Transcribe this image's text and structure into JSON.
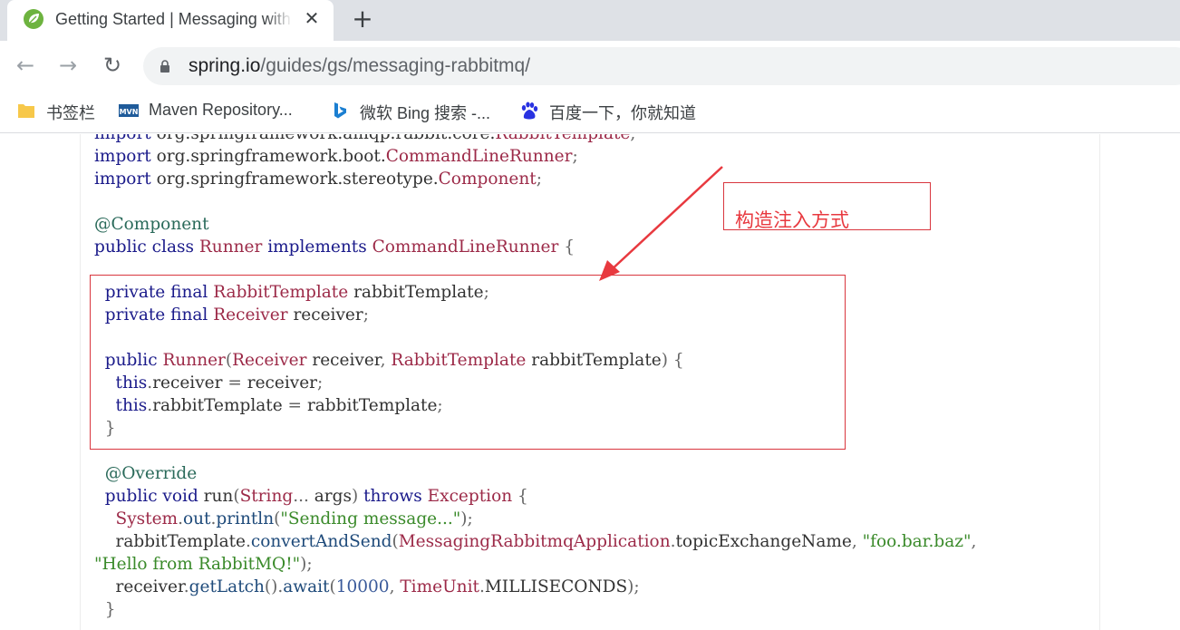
{
  "browser": {
    "tab": {
      "title": "Getting Started | Messaging with RabbitMQ",
      "close": "✕"
    },
    "new_tab": "+",
    "nav": {
      "back": "←",
      "forward": "→",
      "reload": "↻"
    },
    "address": {
      "domain": "spring.io",
      "path": "/guides/gs/messaging-rabbitmq/"
    },
    "bookmarks": [
      {
        "label": "书签栏",
        "icon": "folder-icon"
      },
      {
        "label": "Maven Repository...",
        "icon": "maven-icon"
      },
      {
        "label": "微软 Bing 搜索 -...",
        "icon": "bing-icon"
      },
      {
        "label": "百度一下，你就知道",
        "icon": "baidu-icon"
      }
    ]
  },
  "code": {
    "lines": [
      [
        [
          "kw",
          "import "
        ],
        [
          "",
          "org.springframework.amqp.rabbit.core."
        ],
        [
          "ty",
          "RabbitTemplate"
        ],
        [
          "pn",
          ";"
        ]
      ],
      [
        [
          "kw",
          "import "
        ],
        [
          "",
          "org.springframework.boot."
        ],
        [
          "ty",
          "CommandLineRunner"
        ],
        [
          "pn",
          ";"
        ]
      ],
      [
        [
          "kw",
          "import "
        ],
        [
          "",
          "org.springframework.stereotype."
        ],
        [
          "ty",
          "Component"
        ],
        [
          "pn",
          ";"
        ]
      ],
      [],
      [
        [
          "an",
          "@Component"
        ]
      ],
      [
        [
          "kw",
          "public class "
        ],
        [
          "ty",
          "Runner "
        ],
        [
          "kw",
          "implements "
        ],
        [
          "ty",
          "CommandLineRunner "
        ],
        [
          "pn",
          "{"
        ]
      ],
      [],
      [
        [
          "kw",
          "  private final "
        ],
        [
          "ty",
          "RabbitTemplate "
        ],
        [
          "",
          "rabbitTemplate"
        ],
        [
          "pn",
          ";"
        ]
      ],
      [
        [
          "kw",
          "  private final "
        ],
        [
          "ty",
          "Receiver "
        ],
        [
          "",
          "receiver"
        ],
        [
          "pn",
          ";"
        ]
      ],
      [],
      [
        [
          "kw",
          "  public "
        ],
        [
          "ty",
          "Runner"
        ],
        [
          "pn",
          "("
        ],
        [
          "ty",
          "Receiver "
        ],
        [
          "",
          "receiver"
        ],
        [
          "pn",
          ", "
        ],
        [
          "ty",
          "RabbitTemplate "
        ],
        [
          "",
          "rabbitTemplate"
        ],
        [
          "pn",
          ") {"
        ]
      ],
      [
        [
          "kw",
          "    this"
        ],
        [
          "pn",
          "."
        ],
        [
          "",
          "receiver "
        ],
        [
          "pn",
          "= "
        ],
        [
          "",
          "receiver"
        ],
        [
          "pn",
          ";"
        ]
      ],
      [
        [
          "kw",
          "    this"
        ],
        [
          "pn",
          "."
        ],
        [
          "",
          "rabbitTemplate "
        ],
        [
          "pn",
          "= "
        ],
        [
          "",
          "rabbitTemplate"
        ],
        [
          "pn",
          ";"
        ]
      ],
      [
        [
          "pn",
          "  }"
        ]
      ],
      [],
      [
        [
          "an",
          "  @Override"
        ]
      ],
      [
        [
          "kw",
          "  public void "
        ],
        [
          "",
          "run"
        ],
        [
          "pn",
          "("
        ],
        [
          "ty",
          "String"
        ],
        [
          "pn",
          "... "
        ],
        [
          "",
          "args"
        ],
        [
          "pn",
          ") "
        ],
        [
          "kw",
          "throws "
        ],
        [
          "ty",
          "Exception "
        ],
        [
          "pn",
          "{"
        ]
      ],
      [
        [
          "ty",
          "    System"
        ],
        [
          "pn",
          "."
        ],
        [
          "fn",
          "out"
        ],
        [
          "pn",
          "."
        ],
        [
          "fn",
          "println"
        ],
        [
          "pn",
          "("
        ],
        [
          "str",
          "\"Sending message...\""
        ],
        [
          "pn",
          ");"
        ]
      ],
      [
        [
          "",
          "    rabbitTemplate"
        ],
        [
          "pn",
          "."
        ],
        [
          "fn",
          "convertAndSend"
        ],
        [
          "pn",
          "("
        ],
        [
          "ty",
          "MessagingRabbitmqApplication"
        ],
        [
          "pn",
          "."
        ],
        [
          "",
          "topicExchangeName"
        ],
        [
          "pn",
          ", "
        ],
        [
          "str",
          "\"foo.bar.baz\""
        ],
        [
          "pn",
          ","
        ]
      ],
      [
        [
          "str",
          "\"Hello from RabbitMQ!\""
        ],
        [
          "pn",
          ");"
        ]
      ],
      [
        [
          "",
          "    receiver"
        ],
        [
          "pn",
          "."
        ],
        [
          "fn",
          "getLatch"
        ],
        [
          "pn",
          "()."
        ],
        [
          "fn",
          "await"
        ],
        [
          "pn",
          "("
        ],
        [
          "num",
          "10000"
        ],
        [
          "pn",
          ", "
        ],
        [
          "ty",
          "TimeUnit"
        ],
        [
          "pn",
          "."
        ],
        [
          "",
          "MILLISECONDS"
        ],
        [
          "pn",
          ");"
        ]
      ],
      [
        [
          "pn",
          "  }"
        ]
      ]
    ]
  },
  "annotation": {
    "label": "构造注入方式"
  },
  "colors": {
    "annotation_red": "#d9363e",
    "spring_green": "#6db33f"
  }
}
